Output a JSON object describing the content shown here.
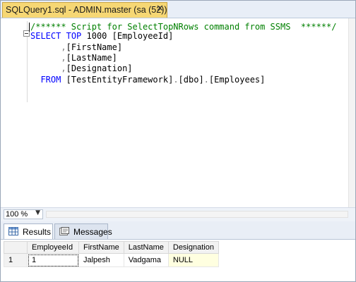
{
  "document_tab": {
    "title": "SQLQuery1.sql - ADMIN.master (sa (52))",
    "close_glyph": "✕"
  },
  "editor": {
    "lines": [
      {
        "parts": [
          {
            "t": "/****** Script for SelectTopNRows command from SSMS  ******/",
            "c": "cm"
          }
        ]
      },
      {
        "parts": [
          {
            "t": "SELECT",
            "c": "kw"
          },
          {
            "t": " ",
            "c": "tx"
          },
          {
            "t": "TOP",
            "c": "kw"
          },
          {
            "t": " 1000 [EmployeeId]",
            "c": "tx"
          }
        ]
      },
      {
        "parts": [
          {
            "t": "      ",
            "c": "tx"
          },
          {
            "t": ",",
            "c": "op"
          },
          {
            "t": "[FirstName]",
            "c": "tx"
          }
        ]
      },
      {
        "parts": [
          {
            "t": "      ",
            "c": "tx"
          },
          {
            "t": ",",
            "c": "op"
          },
          {
            "t": "[LastName]",
            "c": "tx"
          }
        ]
      },
      {
        "parts": [
          {
            "t": "      ",
            "c": "tx"
          },
          {
            "t": ",",
            "c": "op"
          },
          {
            "t": "[Designation]",
            "c": "tx"
          }
        ]
      },
      {
        "parts": [
          {
            "t": "  ",
            "c": "tx"
          },
          {
            "t": "FROM",
            "c": "kw"
          },
          {
            "t": " [TestEntityFramework]",
            "c": "tx"
          },
          {
            "t": ".",
            "c": "op"
          },
          {
            "t": "[dbo]",
            "c": "tx"
          },
          {
            "t": ".",
            "c": "op"
          },
          {
            "t": "[Employees]",
            "c": "tx"
          }
        ]
      }
    ]
  },
  "zoom": {
    "value": "100 %",
    "arrow": "▼"
  },
  "results_tabs": [
    {
      "label": "Results",
      "icon": "grid-icon"
    },
    {
      "label": "Messages",
      "icon": "messages-icon"
    }
  ],
  "grid": {
    "columns": [
      "",
      "EmployeeId",
      "FirstName",
      "LastName",
      "Designation"
    ],
    "rows": [
      [
        "1",
        "1",
        "Jalpesh",
        "Vadgama",
        "NULL"
      ]
    ]
  },
  "colors": {
    "keyword": "#0000ff",
    "comment": "#008000",
    "tab_active": "#f6d774",
    "null_bg": "#ffffe0"
  }
}
